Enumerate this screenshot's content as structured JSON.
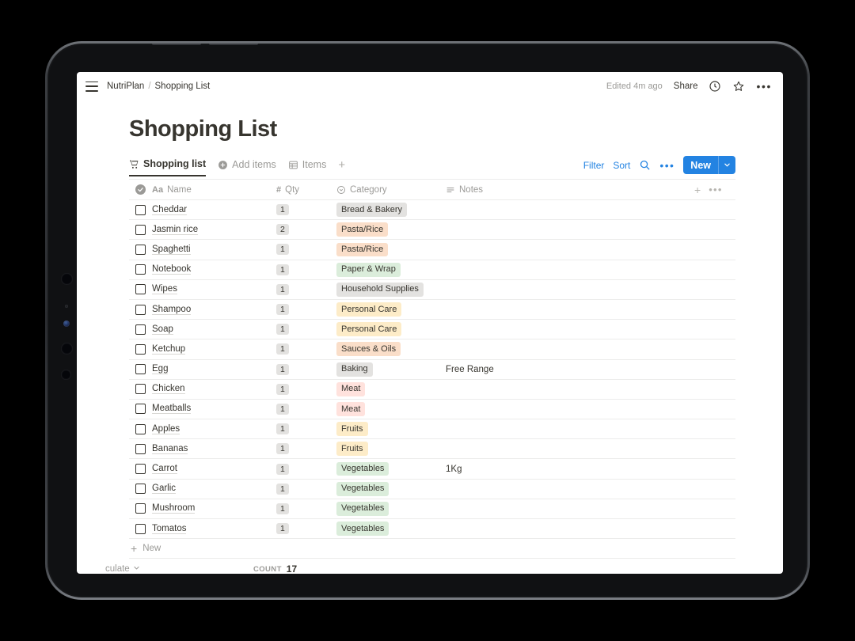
{
  "topbar": {
    "menu_icon": "hamburger-menu-icon",
    "breadcrumb_root": "NutriPlan",
    "breadcrumb_sep": "/",
    "breadcrumb_current": "Shopping List",
    "edited_label": "Edited 4m ago",
    "share_label": "Share",
    "history_icon": "clock-history-icon",
    "favorite_icon": "star-icon",
    "more_icon": "ellipsis-icon",
    "more_label": "•••"
  },
  "page": {
    "title": "Shopping List"
  },
  "tabs": [
    {
      "label": "Shopping list",
      "icon": "shopping-cart-icon",
      "active": true
    },
    {
      "label": "Add items",
      "icon": "plus-circle-icon",
      "active": false
    },
    {
      "label": "Items",
      "icon": "table-grid-icon",
      "active": false
    }
  ],
  "tab_add": "+",
  "toolbar": {
    "filter_label": "Filter",
    "sort_label": "Sort",
    "search_icon": "search-icon",
    "more_icon": "ellipsis-icon",
    "more_label": "•••",
    "new_label": "New",
    "new_chevron_icon": "chevron-down-icon",
    "accent_color": "#2383e2"
  },
  "table": {
    "columns": [
      {
        "key": "check",
        "label": "",
        "icon": "checkbox-circle-icon"
      },
      {
        "key": "name",
        "label": "Name",
        "icon": "text-aa-icon",
        "prefix": "Aa"
      },
      {
        "key": "qty",
        "label": "Qty",
        "icon": "number-hash-icon",
        "prefix": "#"
      },
      {
        "key": "category",
        "label": "Category",
        "icon": "select-circle-icon"
      },
      {
        "key": "notes",
        "label": "Notes",
        "icon": "text-lines-icon"
      }
    ],
    "add_column_icon": "plus-icon",
    "add_column_label": "+",
    "column_options_icon": "ellipsis-icon",
    "column_options_label": "•••",
    "rows": [
      {
        "checked": false,
        "name": "Cheddar",
        "qty": "1",
        "category": "Bread & Bakery",
        "category_color": "#e3e2e0",
        "notes": ""
      },
      {
        "checked": false,
        "name": "Jasmin rice",
        "qty": "2",
        "category": "Pasta/Rice",
        "category_color": "#fadec9",
        "notes": ""
      },
      {
        "checked": false,
        "name": "Spaghetti",
        "qty": "1",
        "category": "Pasta/Rice",
        "category_color": "#fadec9",
        "notes": ""
      },
      {
        "checked": false,
        "name": "Notebook",
        "qty": "1",
        "category": "Paper & Wrap",
        "category_color": "#dbeddb",
        "notes": ""
      },
      {
        "checked": false,
        "name": "Wipes",
        "qty": "1",
        "category": "Household Supplies",
        "category_color": "#e3e2e0",
        "notes": ""
      },
      {
        "checked": false,
        "name": "Shampoo",
        "qty": "1",
        "category": "Personal Care",
        "category_color": "#fdecc8",
        "notes": ""
      },
      {
        "checked": false,
        "name": "Soap",
        "qty": "1",
        "category": "Personal Care",
        "category_color": "#fdecc8",
        "notes": ""
      },
      {
        "checked": false,
        "name": "Ketchup",
        "qty": "1",
        "category": "Sauces & Oils",
        "category_color": "#fadec9",
        "notes": ""
      },
      {
        "checked": false,
        "name": "Egg",
        "qty": "1",
        "category": "Baking",
        "category_color": "#e3e2e0",
        "notes": "Free Range"
      },
      {
        "checked": false,
        "name": "Chicken",
        "qty": "1",
        "category": "Meat",
        "category_color": "#ffe2dd",
        "notes": ""
      },
      {
        "checked": false,
        "name": "Meatballs",
        "qty": "1",
        "category": "Meat",
        "category_color": "#ffe2dd",
        "notes": ""
      },
      {
        "checked": false,
        "name": "Apples",
        "qty": "1",
        "category": "Fruits",
        "category_color": "#fdecc8",
        "notes": ""
      },
      {
        "checked": false,
        "name": "Bananas",
        "qty": "1",
        "category": "Fruits",
        "category_color": "#fdecc8",
        "notes": ""
      },
      {
        "checked": false,
        "name": "Carrot",
        "qty": "1",
        "category": "Vegetables",
        "category_color": "#dbeddb",
        "notes": "1Kg"
      },
      {
        "checked": false,
        "name": "Garlic",
        "qty": "1",
        "category": "Vegetables",
        "category_color": "#dbeddb",
        "notes": ""
      },
      {
        "checked": false,
        "name": "Mushroom",
        "qty": "1",
        "category": "Vegetables",
        "category_color": "#dbeddb",
        "notes": ""
      },
      {
        "checked": false,
        "name": "Tomatos",
        "qty": "1",
        "category": "Vegetables",
        "category_color": "#dbeddb",
        "notes": ""
      }
    ]
  },
  "footer": {
    "new_row_label": "New",
    "new_row_icon": "plus-icon",
    "calculate_label": "culate",
    "calculate_chevron_icon": "chevron-down-icon",
    "count_label": "COUNT",
    "count_value": "17"
  }
}
